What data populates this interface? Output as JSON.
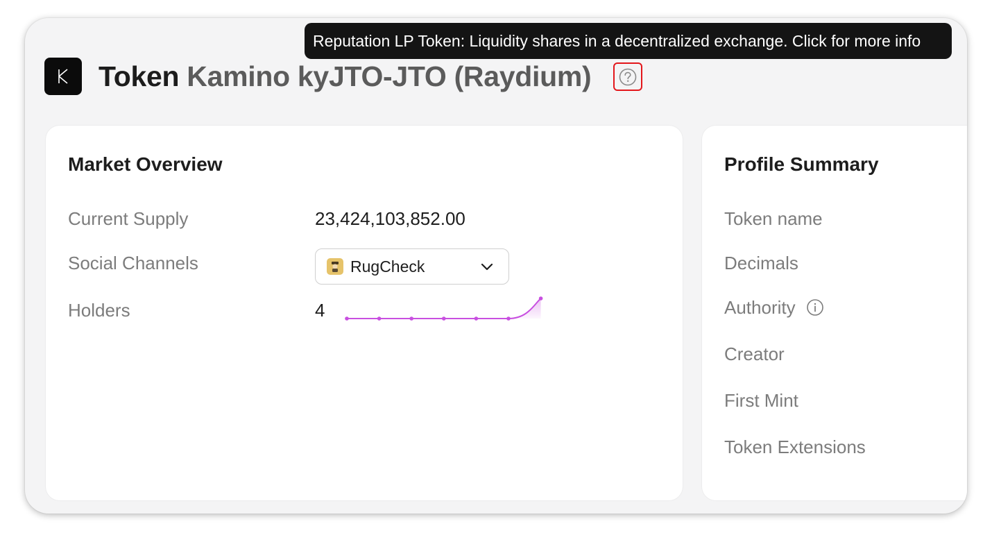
{
  "header": {
    "title_prefix": "Token",
    "title_name": "Kamino kyJTO-JTO (Raydium)",
    "logo_letter": "K"
  },
  "tooltip": {
    "text": "Reputation LP Token: Liquidity shares in a decentralized exchange. Click for more info"
  },
  "market_overview": {
    "title": "Market Overview",
    "current_supply_label": "Current Supply",
    "current_supply_value": "23,424,103,852.00",
    "social_channels_label": "Social Channels",
    "social_channels_selected": "RugCheck",
    "holders_label": "Holders",
    "holders_value": "4",
    "holders_sparkline": [
      0,
      0,
      0,
      0,
      0,
      0,
      1
    ]
  },
  "profile_summary": {
    "title": "Profile Summary",
    "labels": {
      "token_name": "Token name",
      "decimals": "Decimals",
      "authority": "Authority",
      "creator": "Creator",
      "first_mint": "First Mint",
      "token_extensions": "Token Extensions"
    }
  },
  "colors": {
    "accent": "#e3161b",
    "sparkline": "#c84fe0",
    "tooltip_bg": "#141414"
  }
}
